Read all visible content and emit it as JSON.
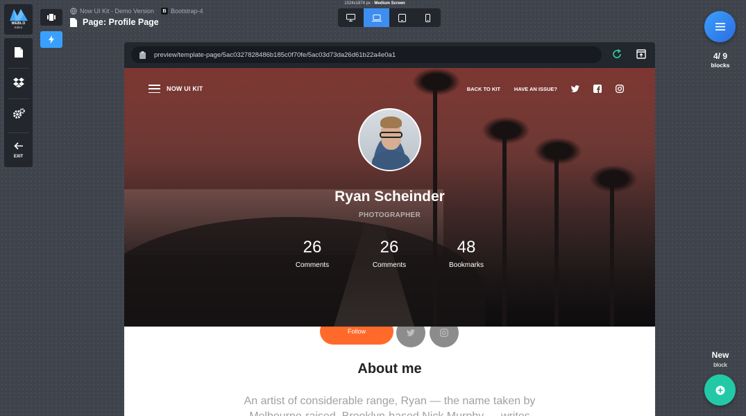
{
  "editor": {
    "logo_text": "WEBLO",
    "logo_sub": "Editor",
    "exit_label": "EXIT",
    "breadcrumb": {
      "project": "Now UI Kit - Demo Version",
      "framework_badge": "B",
      "framework": "Bootstrap-4"
    },
    "page_title": "Page: Profile Page",
    "screen_size": {
      "dims": "1024x1874 px -",
      "name": "Medium Screen"
    },
    "device_toggle": [
      {
        "icon": "desktop-icon",
        "active": false
      },
      {
        "icon": "laptop-icon",
        "active": true
      },
      {
        "icon": "tablet-icon",
        "active": false
      },
      {
        "icon": "mobile-icon",
        "active": false
      }
    ],
    "blocks_count": "4/ 9",
    "blocks_label": "blocks",
    "new_block": {
      "title": "New",
      "sub": "block"
    },
    "colors": {
      "accent": "#3d8ef0",
      "add": "#23c9a7",
      "flash": "#3aa0ff"
    }
  },
  "browser": {
    "url": "preview/template-page/5ac0327828486b185c0f70fe/5ac03d73da26d61b22a4e0a1"
  },
  "site": {
    "brand": "NOW UI KIT",
    "nav": {
      "back": "BACK TO KIT",
      "issue": "HAVE AN ISSUE?"
    },
    "profile": {
      "name": "Ryan Scheinder",
      "role": "PHOTOGRAPHER",
      "stats": [
        {
          "value": "26",
          "label": "Comments"
        },
        {
          "value": "26",
          "label": "Comments"
        },
        {
          "value": "48",
          "label": "Bookmarks"
        }
      ]
    },
    "follow_label": "Follow",
    "about_title": "About me",
    "about_text": "An artist of considerable range, Ryan — the name taken by Melbourne-raised, Brooklyn-based Nick Murphy — writes"
  }
}
